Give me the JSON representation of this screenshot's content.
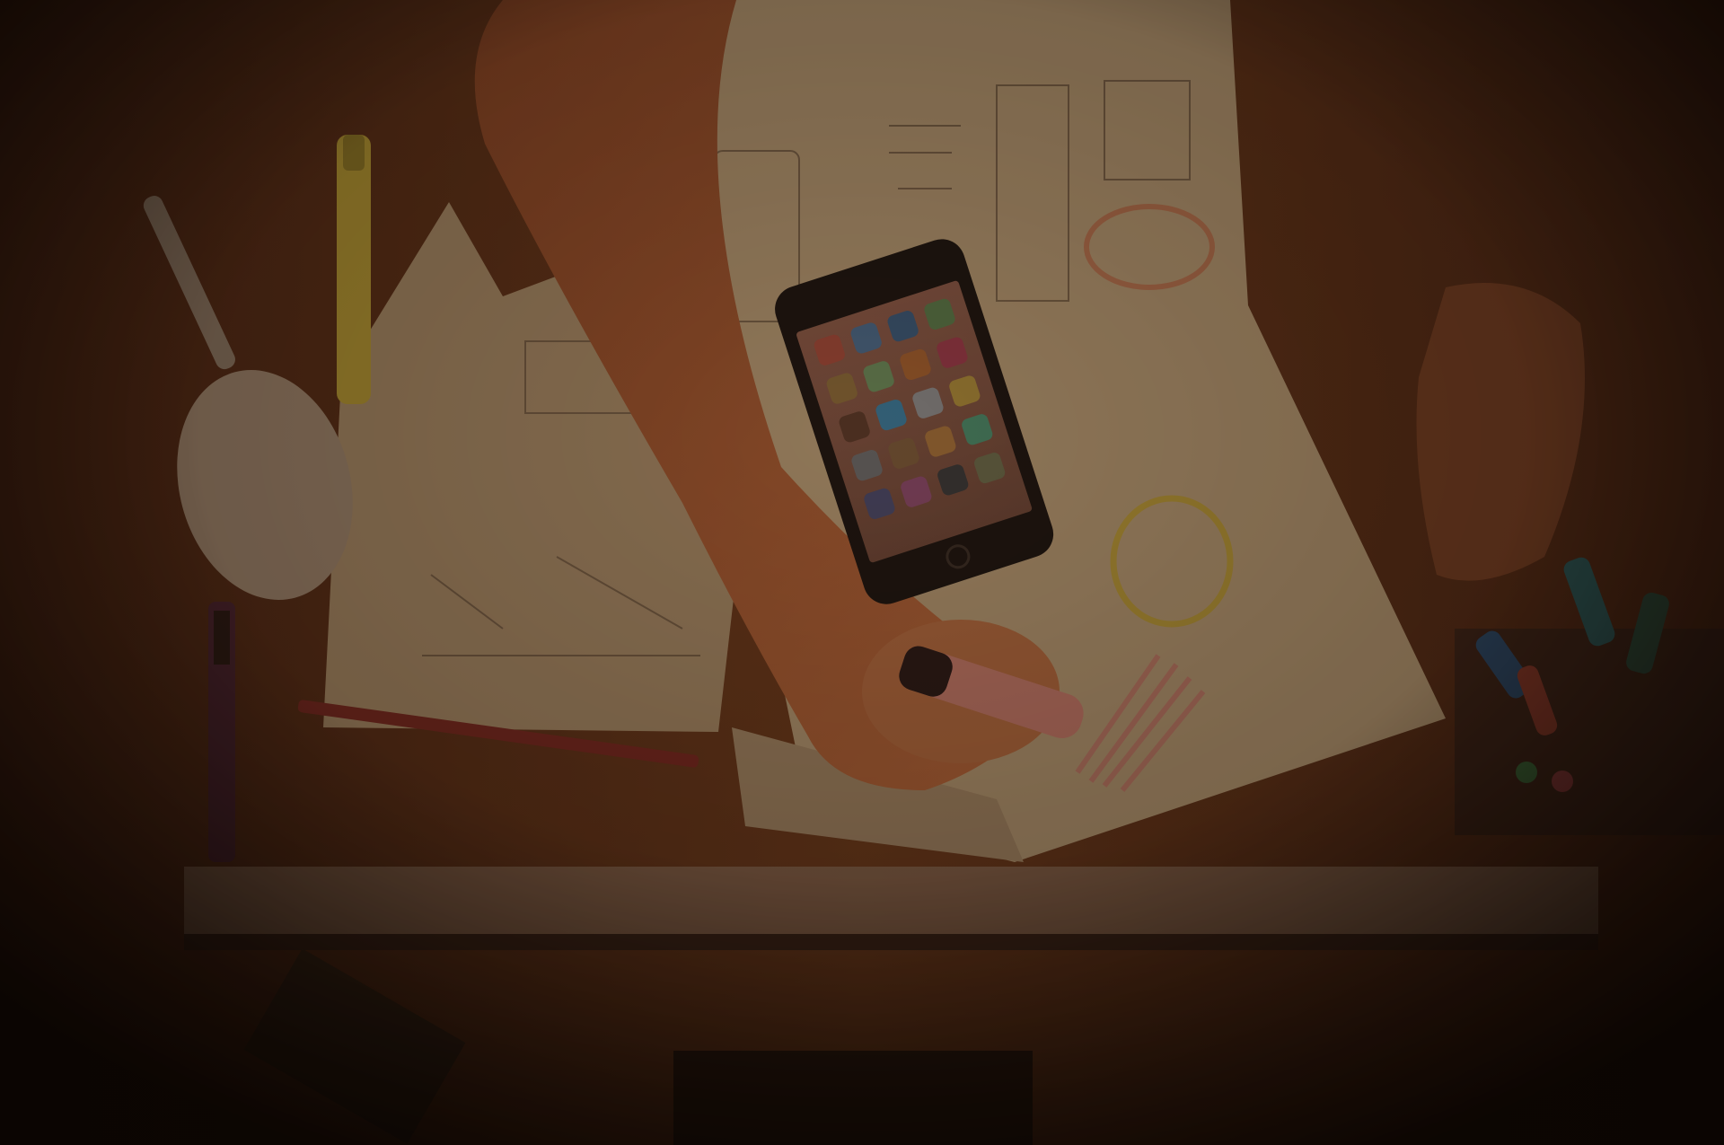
{
  "photo": {
    "subject": "desk-wireframing-scene",
    "colors": {
      "desk_wood": "#6a3a1c",
      "paper": "#b59a74",
      "skin": "#b5673c",
      "phone_body": "#1c1612",
      "marker_pink": "#c47a6a",
      "highlight_yellow": "#b5a03a",
      "vignette": "#0b0503"
    }
  }
}
